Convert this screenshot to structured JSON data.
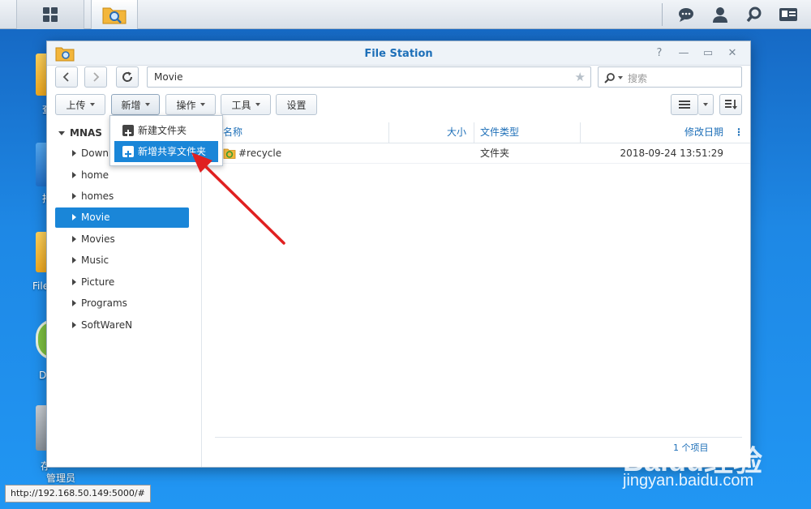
{
  "window": {
    "title": "File Station",
    "controls": {
      "help": "?",
      "minimize": "—",
      "maximize": "▭",
      "close": "✕"
    }
  },
  "toolbar": {
    "path": "Movie",
    "search_placeholder": "搜索",
    "upload": "上传",
    "new": "新增",
    "action": "操作",
    "tools": "工具",
    "settings": "设置"
  },
  "sidebar": {
    "root": "MNAS",
    "items": [
      {
        "label": "Downl"
      },
      {
        "label": "home"
      },
      {
        "label": "homes"
      },
      {
        "label": "Movie",
        "selected": true
      },
      {
        "label": "Movies"
      },
      {
        "label": "Music"
      },
      {
        "label": "Picture"
      },
      {
        "label": "Programs"
      },
      {
        "label": "SoftWareN"
      }
    ]
  },
  "file_list": {
    "columns": {
      "name": "名称",
      "size": "大小",
      "type": "文件类型",
      "modified": "修改日期"
    },
    "rows": [
      {
        "name": "#recycle",
        "size": "",
        "type": "文件夹",
        "modified": "2018-09-24 13:51:29"
      }
    ],
    "footer": "1 个项目"
  },
  "new_menu": {
    "items": [
      {
        "label": "新建文件夹"
      },
      {
        "label": "新增共享文件夹",
        "highlighted": true
      }
    ]
  },
  "desktop": {
    "icon_labels": [
      "查",
      "持",
      "File",
      "D",
      "存",
      "管理员"
    ]
  },
  "status_url": "http://192.168.50.149:5000/#",
  "watermark": {
    "brand": "Baidu经验",
    "site": "jingyan.baidu.com"
  },
  "colors": {
    "accent": "#1a86d8",
    "title": "#1d6fb8",
    "arrow": "#e02020",
    "desktop": "#1e88e5"
  }
}
